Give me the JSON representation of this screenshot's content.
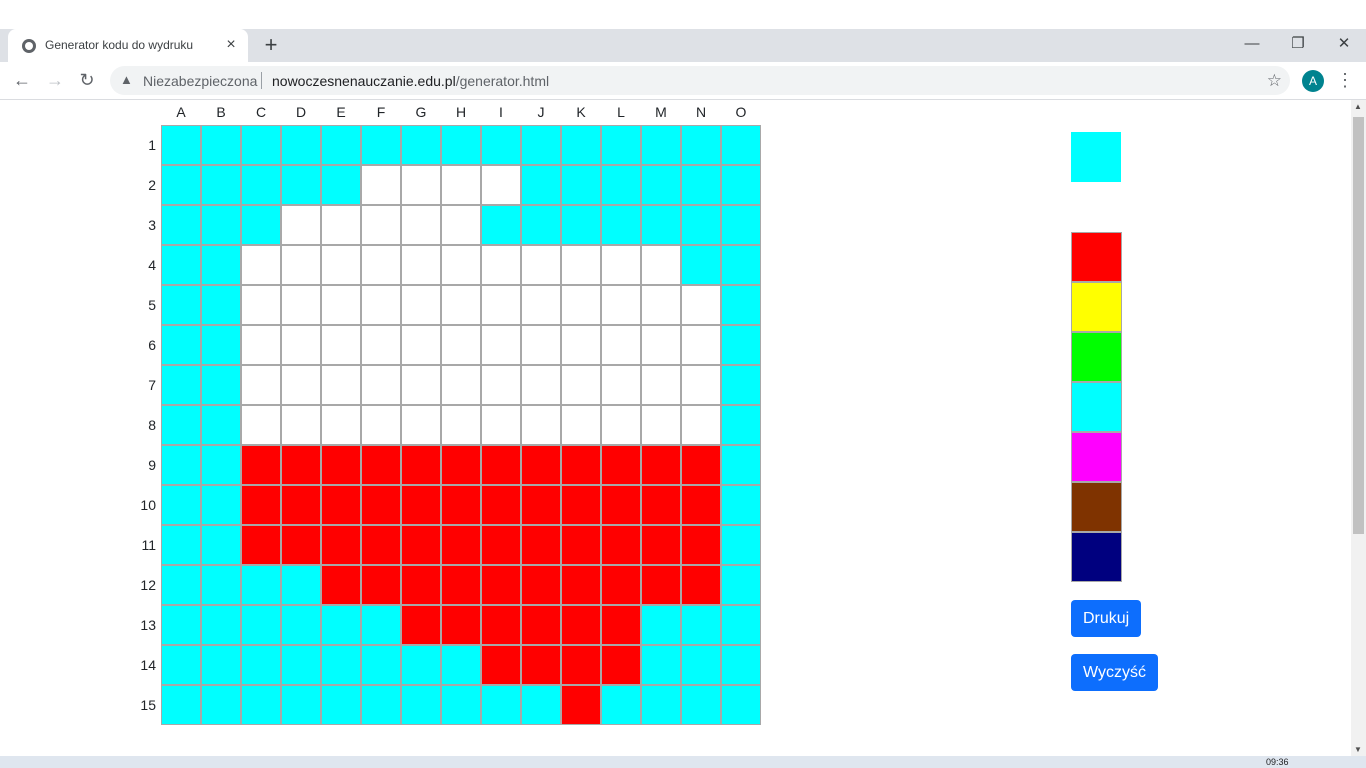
{
  "browser": {
    "tab_title": "Generator kodu do wydruku",
    "tab_close": "×",
    "new_tab": "+",
    "security_label": "Niezabezpieczona",
    "url_host": "nowoczesnenauczanie.edu.pl",
    "url_path": "/generator.html",
    "profile_initial": "A",
    "window_controls": {
      "minimize": "—",
      "restore": "❐",
      "close": "✕"
    }
  },
  "grid": {
    "columns": [
      "A",
      "B",
      "C",
      "D",
      "E",
      "F",
      "G",
      "H",
      "I",
      "J",
      "K",
      "L",
      "M",
      "N",
      "O"
    ],
    "rows": [
      "1",
      "2",
      "3",
      "4",
      "5",
      "6",
      "7",
      "8",
      "9",
      "10",
      "11",
      "12",
      "13",
      "14",
      "15"
    ],
    "palette_map": {
      "c": "#00ffff",
      "w": "#ffffff",
      "r": "#ff0000"
    },
    "pattern": [
      "ccccccccccccccc",
      "cccccwwwwcccccc",
      "cccwwwwwccccccc",
      "ccwwwwwwwwwwwcc",
      "ccwwwwwwwwwwwwc",
      "ccwwwwwwwwwwwwc",
      "ccwwwwwwwwwwwwc",
      "ccwwwwwwwwwwwwc",
      "ccrrrrrrrrrrrrc",
      "ccrrrrrrrrrrrrc",
      "ccrrrrrrrrrrrrc",
      "ccccrrrrrrrrrrc",
      "ccccccrrrrrrccc",
      "ccccccccrrrrccc",
      "ccccccccccrcccc"
    ]
  },
  "current_color": "#00ffff",
  "palette": [
    {
      "name": "red",
      "color": "#ff0000"
    },
    {
      "name": "yellow",
      "color": "#ffff00"
    },
    {
      "name": "green",
      "color": "#00ff00"
    },
    {
      "name": "cyan",
      "color": "#00ffff"
    },
    {
      "name": "magenta",
      "color": "#ff00ff"
    },
    {
      "name": "brown",
      "color": "#7f3300"
    },
    {
      "name": "navy",
      "color": "#00007f"
    }
  ],
  "buttons": {
    "print": "Drukuj",
    "clear": "Wyczyść"
  },
  "taskbar": {
    "clock": "09:36"
  }
}
